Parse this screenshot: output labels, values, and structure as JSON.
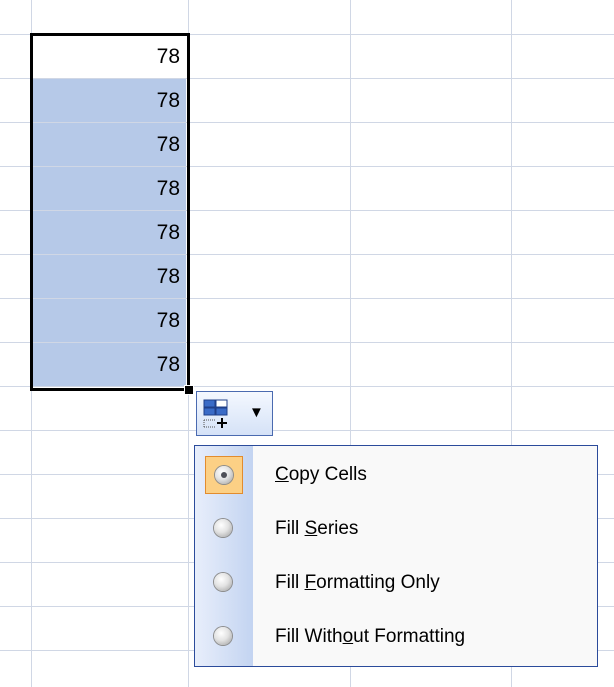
{
  "cells": {
    "values": [
      "78",
      "78",
      "78",
      "78",
      "78",
      "78",
      "78",
      "78"
    ]
  },
  "menu": {
    "items": [
      {
        "pre": "",
        "acc": "C",
        "post": "opy Cells",
        "checked": true
      },
      {
        "pre": "Fill ",
        "acc": "S",
        "post": "eries",
        "checked": false
      },
      {
        "pre": "Fill ",
        "acc": "F",
        "post": "ormatting Only",
        "checked": false
      },
      {
        "pre": "Fill With",
        "acc": "o",
        "post": "ut Formatting",
        "checked": false
      }
    ]
  },
  "colors": {
    "selection_fill": "#b6c9e8",
    "grid_line": "#d0d7e5",
    "menu_border": "#2b4b9b",
    "checked_highlight": "#fcd085"
  },
  "icons": {
    "options_button": "auto-fill-options-icon",
    "dropdown": "chevron-down-icon"
  }
}
